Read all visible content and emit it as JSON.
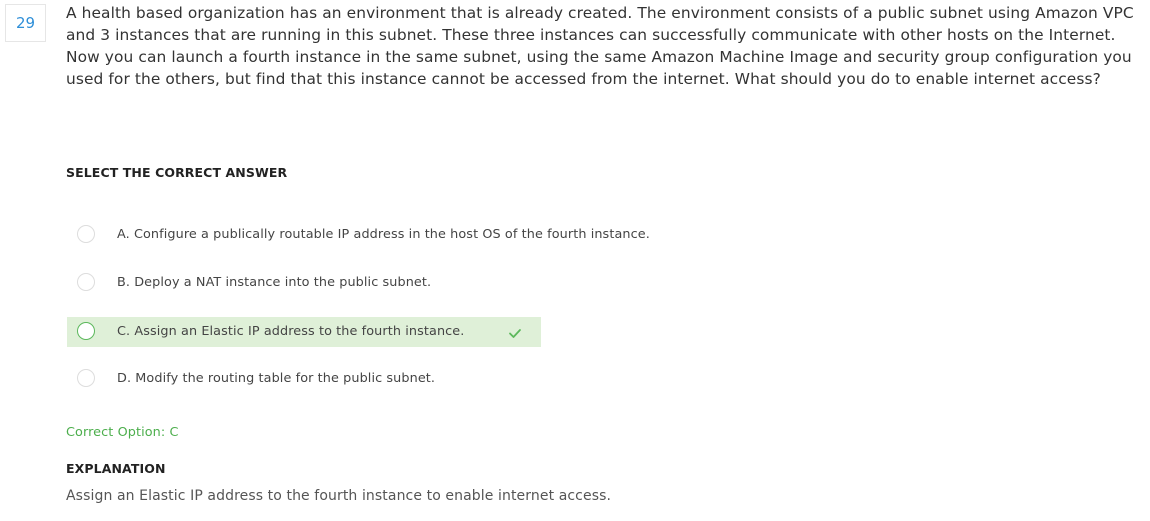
{
  "question": {
    "number": "29",
    "text": "A health based organization has an environment that is already created. The environment consists of a public subnet using Amazon VPC and 3 instances that are running in this subnet. These three instances can successfully communicate with other hosts on the Internet. Now you can launch a fourth instance in the same subnet, using the same Amazon Machine Image and security group configuration you used for the others, but find that this instance cannot be accessed from the internet. What should you do to enable internet access?"
  },
  "select_label": "SELECT THE CORRECT ANSWER",
  "options": [
    {
      "text": "A. Configure a publically routable IP address in the host OS of the fourth instance.",
      "correct": false
    },
    {
      "text": "B. Deploy a NAT instance into the public subnet.",
      "correct": false
    },
    {
      "text": "C. Assign an Elastic IP address to the fourth instance.",
      "correct": true
    },
    {
      "text": "D. Modify the routing table for the public subnet.",
      "correct": false
    }
  ],
  "correct_option_text": "Correct Option: C",
  "explanation": {
    "label": "EXPLANATION",
    "text": "Assign an Elastic IP address to the fourth instance to enable internet access."
  },
  "colors": {
    "accent": "#2f8fd8",
    "correct_bg": "#dff0d8",
    "correct_green": "#5cb85c"
  },
  "icons": {
    "correct": "checkmark-icon"
  }
}
